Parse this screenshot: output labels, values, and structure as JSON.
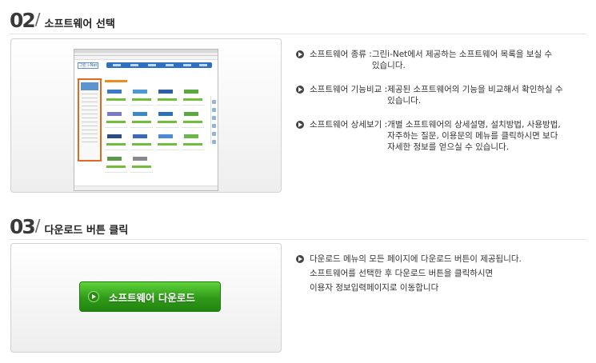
{
  "steps": [
    {
      "number": "02",
      "title": "소프트웨어 선택"
    },
    {
      "number": "03",
      "title": "다운로드 버튼 클릭"
    }
  ],
  "mini_screenshot": {
    "logo_text": "그린 i-Net"
  },
  "step2_items": [
    {
      "term": "소프트웨어 종류 : ",
      "lines": [
        "그린i-Net에서 제공하는 소프트웨어 목록을 보실 수",
        "있습니다."
      ]
    },
    {
      "term": "소프트웨어 기능비교 : ",
      "lines": [
        "제공된 소프트웨어의 기능을 비교해서 확인하실 수",
        "있습니다."
      ]
    },
    {
      "term": "소프트웨어 상세보기 : ",
      "lines": [
        "개별 소프트웨어의 상세설명, 설치방법, 사용방법,",
        "자주하는 질문, 이용문의 메뉴를 클릭하시면 보다",
        "자세한 정보를 얻으실 수 있습니다."
      ]
    }
  ],
  "download_button": {
    "label": "소프트웨어 다운로드"
  },
  "step3_lines": [
    "다운로드 메뉴의 모든 페이지에 다운로드 버튼이 제공됩니다.",
    "소프트웨어를 선택한 후 다운로드 버튼을 클릭하시면",
    "이용자 정보입력페이지로 이동합니다"
  ],
  "colors": {
    "highlight_border": "#e06b1a",
    "button_green": "#2f9a18",
    "nav_blue": "#2d6fc0"
  }
}
